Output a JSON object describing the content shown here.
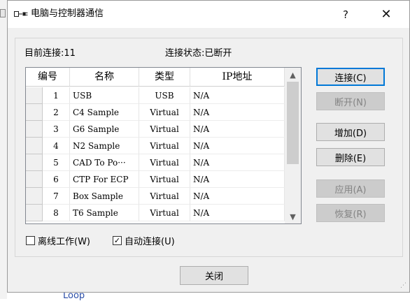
{
  "window": {
    "title": "电脑与控制器通信",
    "help_glyph": "?",
    "close_glyph": "✕"
  },
  "status": {
    "connections_label": "目前连接:11",
    "state_label": "连接状态:已断开"
  },
  "table": {
    "headers": [
      "编号",
      "名称",
      "类型",
      "IP地址"
    ],
    "rows": [
      {
        "num": "1",
        "name": "USB",
        "type": "USB",
        "ip": "N/A"
      },
      {
        "num": "2",
        "name": "C4 Sample",
        "type": "Virtual",
        "ip": "N/A"
      },
      {
        "num": "3",
        "name": "G6 Sample",
        "type": "Virtual",
        "ip": "N/A"
      },
      {
        "num": "4",
        "name": "N2 Sample",
        "type": "Virtual",
        "ip": "N/A"
      },
      {
        "num": "5",
        "name": "CAD To Po···",
        "type": "Virtual",
        "ip": "N/A"
      },
      {
        "num": "6",
        "name": "CTP For ECP",
        "type": "Virtual",
        "ip": "N/A"
      },
      {
        "num": "7",
        "name": "Box Sample",
        "type": "Virtual",
        "ip": "N/A"
      },
      {
        "num": "8",
        "name": "T6 Sample",
        "type": "Virtual",
        "ip": "N/A"
      }
    ],
    "scroll_up_glyph": "▲",
    "scroll_down_glyph": "▼"
  },
  "buttons": {
    "connect": "连接(C)",
    "disconnect": "断开(N)",
    "add": "增加(D)",
    "delete": "删除(E)",
    "apply": "应用(A)",
    "restore": "恢复(R)",
    "close": "关闭"
  },
  "checkboxes": {
    "offline": {
      "label": "离线工作(W)",
      "checked": false
    },
    "auto_connect": {
      "label": "自动连接(U)",
      "checked": true,
      "check_glyph": "✓"
    }
  },
  "background": {
    "text": "Loop"
  },
  "colors": {
    "accent": "#0078d7",
    "disabled_text": "#838383",
    "link_text": "#2b4ea8"
  }
}
